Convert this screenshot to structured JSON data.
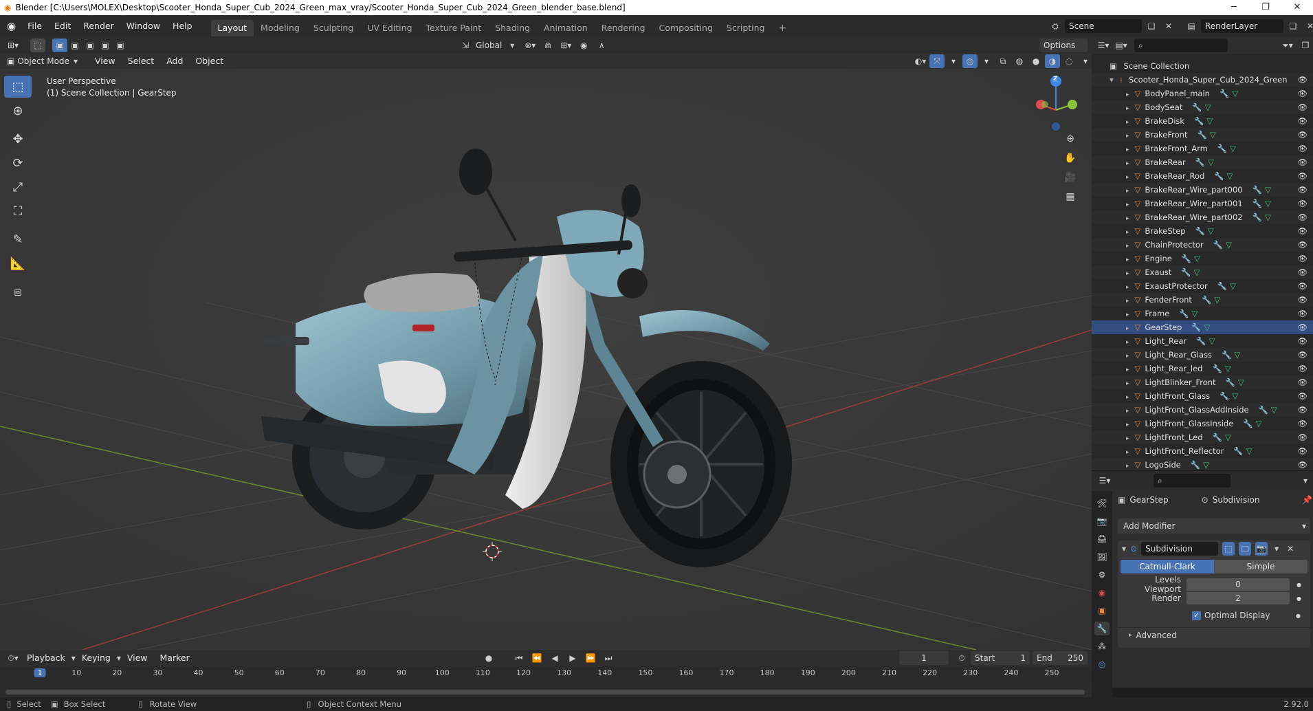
{
  "window": {
    "title": "Blender [C:\\Users\\MOLEX\\Desktop\\Scooter_Honda_Super_Cub_2024_Green_max_vray/Scooter_Honda_Super_Cub_2024_Green_blender_base.blend]"
  },
  "menus": [
    "File",
    "Edit",
    "Render",
    "Window",
    "Help"
  ],
  "workspaces": [
    "Layout",
    "Modeling",
    "Sculpting",
    "UV Editing",
    "Texture Paint",
    "Shading",
    "Animation",
    "Rendering",
    "Compositing",
    "Scripting"
  ],
  "scene": {
    "name": "Scene",
    "render_layer": "RenderLayer"
  },
  "viewport": {
    "mode": "Object Mode",
    "menus": [
      "View",
      "Select",
      "Add",
      "Object"
    ],
    "transform": "Global",
    "options": "Options",
    "overlay_title": "User Perspective",
    "overlay_subtitle": "(1) Scene Collection | GearStep",
    "gizmo_z": "Z"
  },
  "outliner": {
    "root": "Scene Collection",
    "collection": "Scooter_Honda_Super_Cub_2024_Green",
    "items": [
      "BodyPanel_main",
      "BodySeat",
      "BrakeDisk",
      "BrakeFront",
      "BrakeFront_Arm",
      "BrakeRear",
      "BrakeRear_Rod",
      "BrakeRear_Wire_part000",
      "BrakeRear_Wire_part001",
      "BrakeRear_Wire_part002",
      "BrakeStep",
      "ChainProtector",
      "Engine",
      "Exaust",
      "ExaustProtector",
      "FenderFront",
      "Frame",
      "GearStep",
      "Light_Rear",
      "Light_Rear_Glass",
      "Light_Rear_led",
      "LightBlinker_Front",
      "LightFront_Glass",
      "LightFront_GlassAddInside",
      "LightFront_GlassInside",
      "LightFront_Led",
      "LightFront_Reflector",
      "LogoSide"
    ],
    "selected": "GearStep"
  },
  "properties": {
    "object": "GearStep",
    "modifier_breadcrumb": "Subdivision",
    "add_modifier": "Add Modifier",
    "modifier_name": "Subdivision",
    "algo_options": [
      "Catmull-Clark",
      "Simple"
    ],
    "levels_viewport_label": "Levels Viewport",
    "levels_viewport": "0",
    "render_label": "Render",
    "render_value": "2",
    "optimal_display": "Optimal Display",
    "advanced": "Advanced"
  },
  "timeline": {
    "menus": [
      "Playback",
      "Keying",
      "View",
      "Marker"
    ],
    "current_frame": "1",
    "start_label": "Start",
    "start": "1",
    "end_label": "End",
    "end": "250",
    "ticks": [
      "1",
      "10",
      "20",
      "30",
      "40",
      "50",
      "60",
      "70",
      "80",
      "90",
      "100",
      "110",
      "120",
      "130",
      "140",
      "150",
      "160",
      "170",
      "180",
      "190",
      "200",
      "210",
      "220",
      "230",
      "240",
      "250"
    ]
  },
  "status": {
    "select": "Select",
    "box_select": "Box Select",
    "rotate_view": "Rotate View",
    "context_menu": "Object Context Menu",
    "version": "2.92.0"
  },
  "colors": {
    "accent": "#4772b3",
    "selected_row": "#334d80",
    "object_icon": "#e8883a",
    "axis_x": "#e34a4a",
    "axis_y": "#8ac43a",
    "axis_z": "#3d88e6",
    "bike_body": "#7da6b5"
  }
}
